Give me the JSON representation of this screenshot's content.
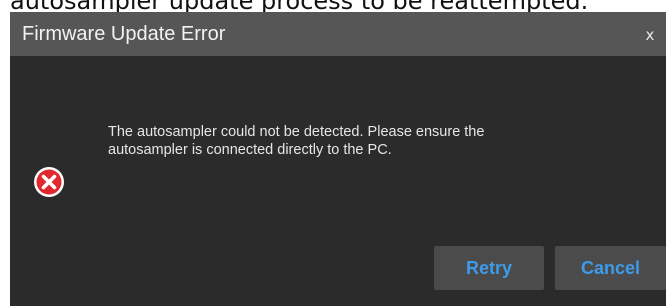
{
  "background": {
    "partial_text": "autosampler update process to be reattempted."
  },
  "dialog": {
    "title": "Firmware Update Error",
    "close_label": "x",
    "message_line1": "The autosampler could not be detected. Please ensure the",
    "message_line2": "autosampler is connected directly to the PC.",
    "icon": "error-icon",
    "buttons": {
      "retry": "Retry",
      "cancel": "Cancel"
    }
  },
  "colors": {
    "dialog_bg": "#2b2b2b",
    "titlebar_bg": "#565656",
    "button_bg": "#4b4b4b",
    "button_text": "#3d9bea",
    "error_red": "#e0282e"
  }
}
